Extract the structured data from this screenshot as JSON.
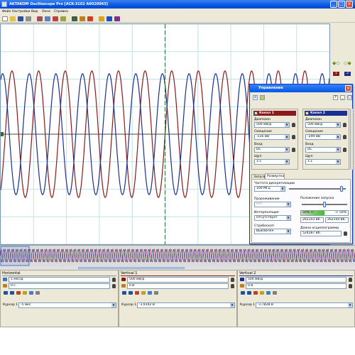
{
  "window": {
    "title": "AKTAKOM Oscilloscope Pro [ACK-3102 A0020043]"
  },
  "menu": [
    "Файл",
    "Настройки",
    "Вид",
    "Окно",
    "Справка"
  ],
  "toolbar": {
    "icons": [
      "new-icon",
      "open-icon",
      "save-icon",
      "print-icon",
      "cut-icon",
      "copy-icon",
      "settings-icon",
      "chart-icon",
      "cursor-icon",
      "run-icon",
      "stop-icon",
      "hand-icon",
      "measure-icon",
      "info-icon"
    ]
  },
  "colors": {
    "channel1": "#8b1a1a",
    "channel2": "#1a2f8f",
    "grid": "#bfe3e6",
    "plot_bg": "#ffffff",
    "cursor": "#2f6b2f"
  },
  "right_strip": {
    "ch1_badge": "1",
    "ch2_badge": "2"
  },
  "control": {
    "title": "Управление",
    "ch1": {
      "header": "Канал 1",
      "range_label": "Диапазон",
      "range_value": "500 мВ/д",
      "offset_label": "Смещение",
      "offset_value": "-116 мВ",
      "input_label": "Вход",
      "input_value": "DC",
      "probe_label": "Щуп",
      "probe_value": "1:1"
    },
    "ch2": {
      "header": "Канал 2",
      "range_label": "Диапазон",
      "range_value": "500 мВ/д",
      "offset_label": "Смещение",
      "offset_value": "-249 мВ",
      "input_label": "Вход",
      "input_value": "DC",
      "probe_label": "Щуп",
      "probe_value": "1:1"
    },
    "tabs": [
      "Запуск",
      "Развертка"
    ],
    "sampling_label": "Частота дискретизации",
    "sampling_value": "100 МГц",
    "sampling_level": 0.92,
    "thinning_label": "Прореживание",
    "thinning_value": "Нет",
    "interp_label": "Интерполяция",
    "interp_value": "Отсутствует",
    "strobe_label": "Стробоскоп",
    "strobe_value": "Выключен",
    "trigpos_label": "Положение запуска",
    "trigpos_level": 0.5,
    "trigpos_left": "50% <-",
    "trigpos_right": "-> 50%",
    "pre_samples": "262143 Вб.",
    "post_samples": "262144 Вб.",
    "length_label": "Длина осциллограммы",
    "length_value": "524287 Вб."
  },
  "panels": {
    "horizontal": {
      "title": "Horizontal",
      "timebase": "1 мкс/д",
      "position": "0 с",
      "cursor_label": "Курсор 1",
      "cursor_value": "-5 мкс"
    },
    "vertical1": {
      "title": "Vertical 1",
      "scale": "500 мВ/д",
      "offset": "0 В",
      "cursor_label": "Курсор 1",
      "cursor_value": "-1,9142 В"
    },
    "vertical2": {
      "title": "Vertical 2",
      "scale": "500 мВ/д",
      "offset": "0 В",
      "cursor_label": "Курсор 1",
      "cursor_value": "-1,7828 В"
    }
  },
  "chart_data": {
    "type": "line",
    "grid": true,
    "xlim": [
      -5,
      5
    ],
    "ylim": [
      -4,
      4
    ],
    "series": [
      {
        "amplitude": 2.3,
        "period": 0.81,
        "phase": 0.0,
        "color": "#8b1a1a"
      },
      {
        "amplitude": 2.2,
        "period": 0.81,
        "phase": 0.35,
        "color": "#1a2f8f"
      }
    ]
  }
}
